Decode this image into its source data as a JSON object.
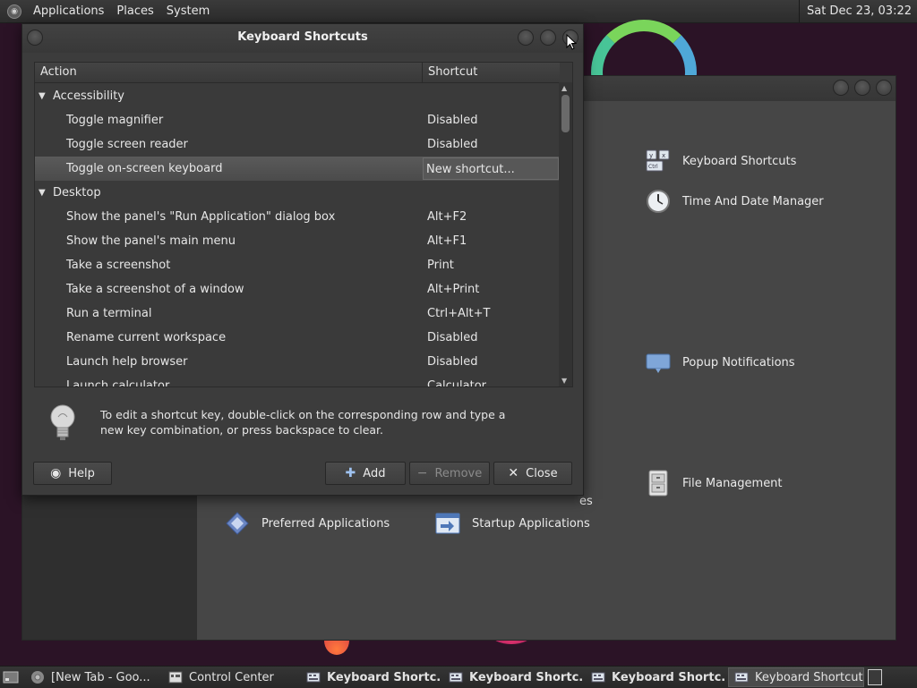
{
  "top_panel": {
    "menus": [
      "Applications",
      "Places",
      "System"
    ],
    "clock": "Sat Dec 23, 03:22"
  },
  "control_center": {
    "items": [
      {
        "label": "Keyboard Shortcuts",
        "icon": "keyboard-icon"
      },
      {
        "label": "Time And Date Manager",
        "icon": "clock-icon"
      },
      {
        "label": "Popup Notifications",
        "icon": "notification-icon"
      },
      {
        "label": "File Management",
        "icon": "file-cabinet-icon"
      },
      {
        "label": "Preferred Applications",
        "icon": "preferred-apps-icon"
      },
      {
        "label": "Startup Applications",
        "icon": "startup-apps-icon"
      }
    ],
    "partial_text": "es"
  },
  "dialog": {
    "title": "Keyboard Shortcuts",
    "columns": {
      "action": "Action",
      "shortcut": "Shortcut"
    },
    "rows": [
      {
        "type": "category",
        "label": "Accessibility"
      },
      {
        "type": "item",
        "action": "Toggle magnifier",
        "shortcut": "Disabled"
      },
      {
        "type": "item",
        "action": "Toggle screen reader",
        "shortcut": "Disabled"
      },
      {
        "type": "item",
        "action": "Toggle on-screen keyboard",
        "shortcut": "New shortcut...",
        "selected": true
      },
      {
        "type": "category",
        "label": "Desktop"
      },
      {
        "type": "item",
        "action": "Show the panel's \"Run Application\" dialog box",
        "shortcut": "Alt+F2"
      },
      {
        "type": "item",
        "action": "Show the panel's main menu",
        "shortcut": "Alt+F1"
      },
      {
        "type": "item",
        "action": "Take a screenshot",
        "shortcut": "Print"
      },
      {
        "type": "item",
        "action": "Take a screenshot of a window",
        "shortcut": "Alt+Print"
      },
      {
        "type": "item",
        "action": "Run a terminal",
        "shortcut": "Ctrl+Alt+T"
      },
      {
        "type": "item",
        "action": "Rename current workspace",
        "shortcut": "Disabled"
      },
      {
        "type": "item",
        "action": "Launch help browser",
        "shortcut": "Disabled"
      },
      {
        "type": "item",
        "action": "Launch calculator",
        "shortcut": "Calculator"
      }
    ],
    "hint": "To edit a shortcut key, double-click on the corresponding row and type a new key combination, or press backspace to clear.",
    "buttons": {
      "help": "Help",
      "add": "Add",
      "remove": "Remove",
      "close": "Close"
    }
  },
  "taskbar": {
    "items": [
      {
        "label": "[New Tab - Goo...",
        "icon": "chrome-icon"
      },
      {
        "label": "Control Center",
        "icon": "control-center-icon"
      },
      {
        "label": "Keyboard Shortc...",
        "icon": "keyboard-icon"
      },
      {
        "label": "Keyboard Shortc...",
        "icon": "keyboard-icon"
      },
      {
        "label": "Keyboard Shortc...",
        "icon": "keyboard-icon"
      },
      {
        "label": "Keyboard Shortcuts",
        "icon": "keyboard-icon",
        "active": true
      }
    ]
  }
}
